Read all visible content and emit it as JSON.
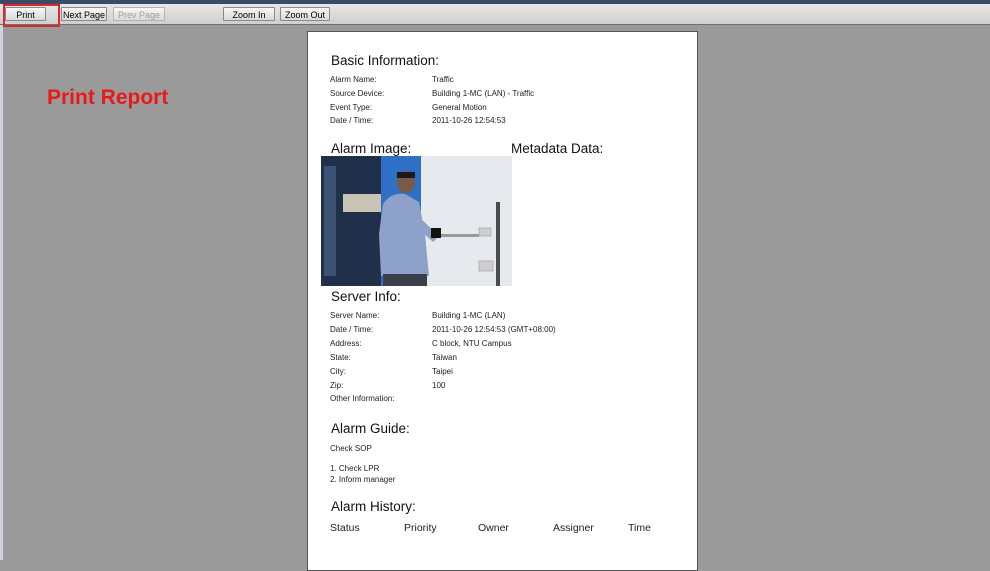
{
  "toolbar": {
    "print": "Print",
    "next_page": "Next Page",
    "prev_page": "Prev Page",
    "zoom_in": "Zoom In",
    "zoom_out": "Zoom Out"
  },
  "callout": "Print Report",
  "report": {
    "basic": {
      "title": "Basic Information:",
      "rows": [
        {
          "label": "Alarm Name:",
          "value": "Traffic"
        },
        {
          "label": "Source Device:",
          "value": "Building 1-MC (LAN) - Traffic"
        },
        {
          "label": "Event Type:",
          "value": "General Motion"
        },
        {
          "label": "Date / Time:",
          "value": "2011-10-26 12:54:53"
        }
      ]
    },
    "alarm_image_title": "Alarm Image:",
    "metadata_title": "Metadata Data:",
    "server": {
      "title": "Server Info:",
      "rows": [
        {
          "label": "Server Name:",
          "value": "Building 1-MC (LAN)"
        },
        {
          "label": "Date / Time:",
          "value": "2011-10-26 12:54:53 (GMT+08:00)"
        },
        {
          "label": "Address:",
          "value": "C block, NTU Campus"
        },
        {
          "label": "State:",
          "value": "Taiwan"
        },
        {
          "label": "City:",
          "value": "Taipei"
        },
        {
          "label": "Zip:",
          "value": "100"
        },
        {
          "label": "Other Information:",
          "value": ""
        }
      ]
    },
    "guide": {
      "title": "Alarm Guide:",
      "check": "Check SOP",
      "step1": "1. Check LPR",
      "step2": "2. Inform manager"
    },
    "history": {
      "title": "Alarm History:",
      "columns": [
        "Status",
        "Priority",
        "Owner",
        "Assigner",
        "Time"
      ]
    }
  },
  "colors": {
    "callout": "#e8191b",
    "highlight_box": "#d92a2a",
    "background": "#9a9a9a"
  }
}
